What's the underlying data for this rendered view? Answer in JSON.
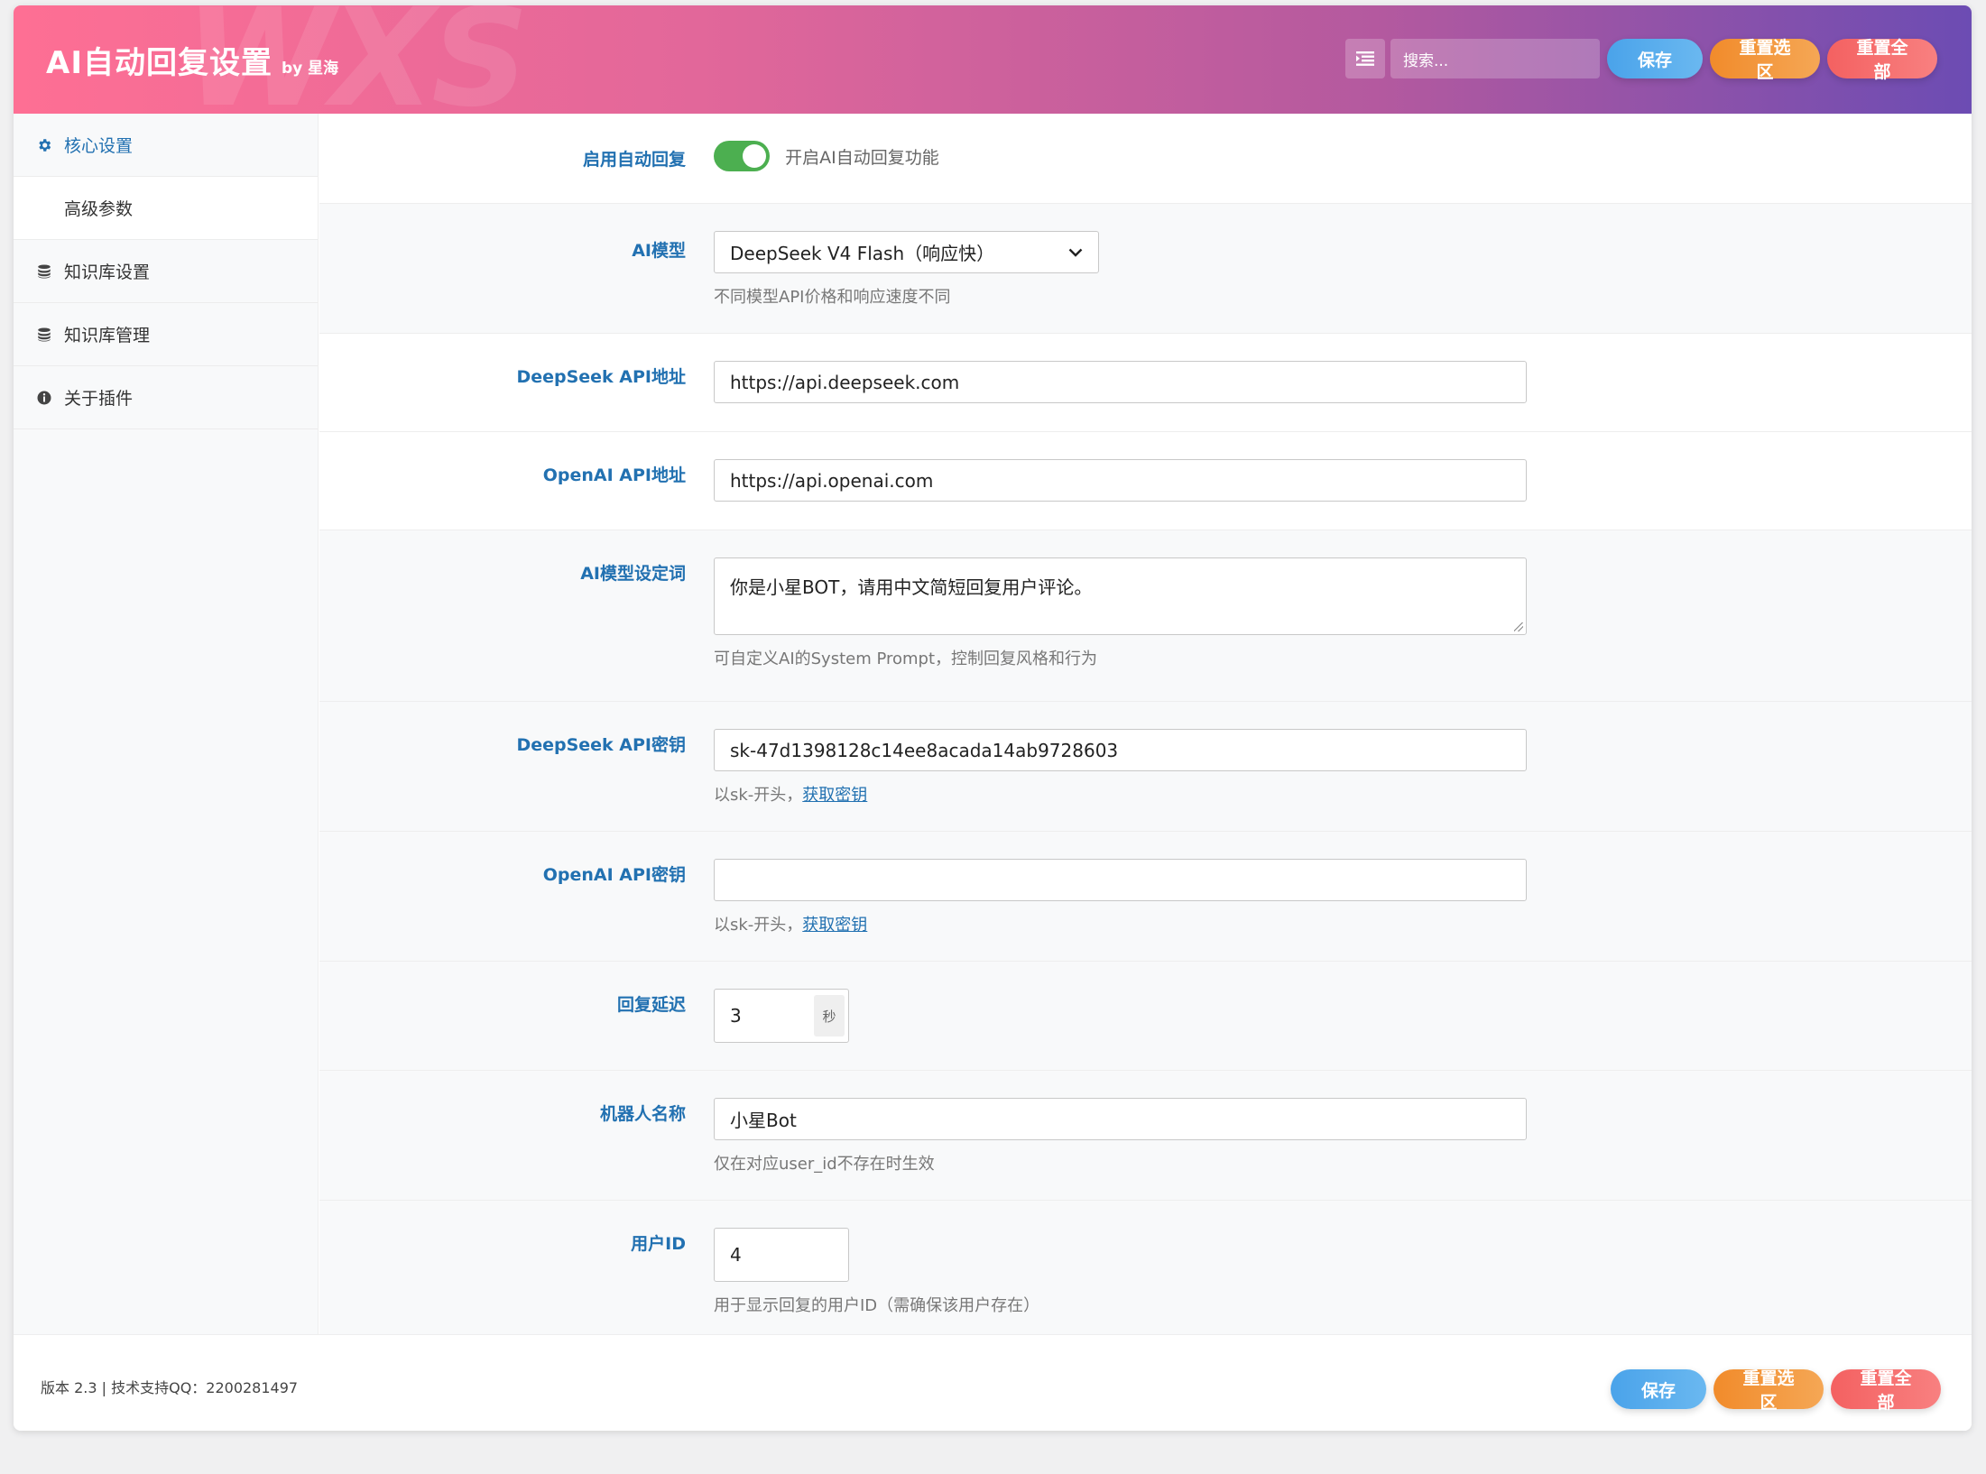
{
  "header": {
    "title": "AI自动回复设置",
    "by": "by 星海",
    "watermark": "WXS",
    "search_placeholder": "搜索...",
    "save_label": "保存",
    "reset_section_label": "重置选区",
    "reset_all_label": "重置全部"
  },
  "sidebar": {
    "items": [
      {
        "label": "核心设置",
        "icon": "gear-icon"
      },
      {
        "label": "高级参数",
        "icon": ""
      },
      {
        "label": "知识库设置",
        "icon": "database-icon"
      },
      {
        "label": "知识库管理",
        "icon": "database-icon"
      },
      {
        "label": "关于插件",
        "icon": "info-icon"
      }
    ]
  },
  "form": {
    "enable": {
      "label": "启用自动回复",
      "text": "开启AI自动回复功能",
      "checked": true
    },
    "model": {
      "label": "AI模型",
      "value": "DeepSeek V4 Flash（响应快）",
      "desc": "不同模型API价格和响应速度不同"
    },
    "deepseek_url": {
      "label": "DeepSeek API地址",
      "value": "https://api.deepseek.com"
    },
    "openai_url": {
      "label": "OpenAI API地址",
      "value": "https://api.openai.com"
    },
    "prompt": {
      "label": "AI模型设定词",
      "value": "你是小星BOT，请用中文简短回复用户评论。",
      "desc": "可自定义AI的System Prompt，控制回复风格和行为"
    },
    "deepseek_key": {
      "label": "DeepSeek API密钥",
      "value": "sk-47d1398128c14ee8acada14ab9728603",
      "desc_prefix": "以sk-开头，",
      "desc_link": "获取密钥"
    },
    "openai_key": {
      "label": "OpenAI API密钥",
      "value": "",
      "desc_prefix": "以sk-开头，",
      "desc_link": "获取密钥"
    },
    "delay": {
      "label": "回复延迟",
      "value": "3",
      "unit": "秒"
    },
    "bot_name": {
      "label": "机器人名称",
      "value": "小星Bot",
      "desc": "仅在对应user_id不存在时生效"
    },
    "user_id": {
      "label": "用户ID",
      "value": "4",
      "desc": "用于显示回复的用户ID（需确保该用户存在）"
    }
  },
  "footer": {
    "text": "版本 2.3 | 技术支持QQ：2200281497",
    "save_label": "保存",
    "reset_section_label": "重置选区",
    "reset_all_label": "重置全部"
  },
  "colors": {
    "accent": "#2271b1",
    "toggle_on": "#4caf50",
    "header_start": "#fe6f94",
    "header_end": "#6c4cb3"
  }
}
